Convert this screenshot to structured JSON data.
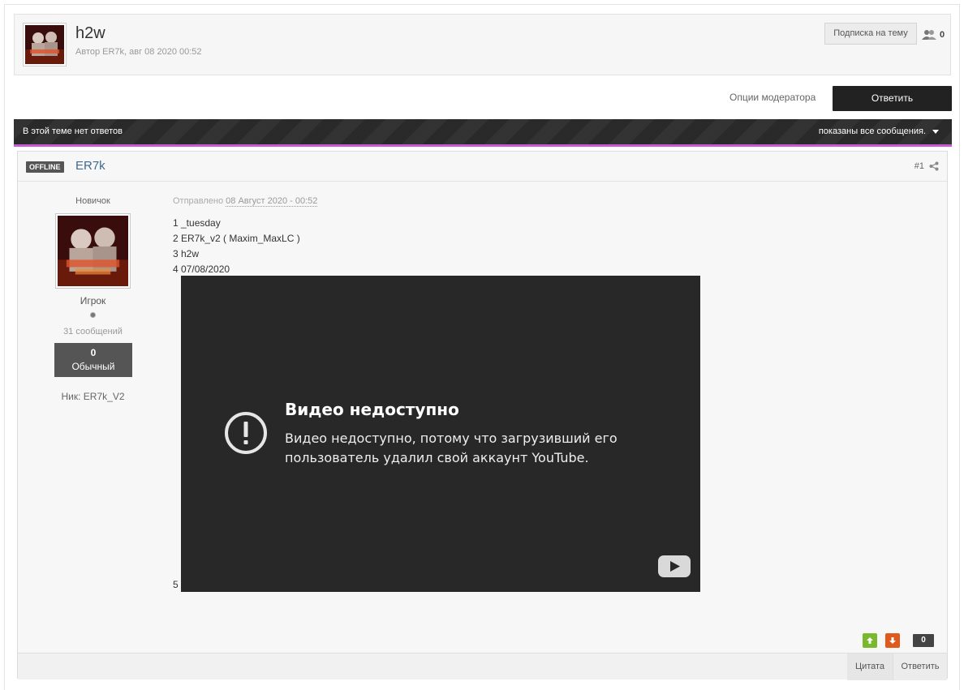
{
  "topic": {
    "title": "h2w",
    "meta": "Автор ER7k, авг 08 2020 00:52",
    "subscribe_label": "Подписка на тему",
    "followers_count": "0"
  },
  "actions": {
    "mod_options_label": "Опции модератора",
    "reply_label": "Ответить"
  },
  "topic_bar": {
    "left_text": "В этой теме нет ответов",
    "right_text": "показаны все сообщения."
  },
  "post": {
    "status_badge": "OFFLINE",
    "author": "ER7k",
    "number": "#1",
    "rank_title": "Новичок",
    "group": "Игрок",
    "post_count": "31 сообщений",
    "reputation_value": "0",
    "reputation_label": "Обычный",
    "nick_label": "Ник:",
    "nick_value": "ER7k_V2",
    "posted_prefix": "Отправлено",
    "posted_date": "08 Август 2020 - 00:52",
    "lines": [
      "1 _tuesday",
      "2 ER7k_v2 ( Maxim_MaxLC )",
      "3 h2w",
      "4 07/08/2020"
    ],
    "line5": "5",
    "video": {
      "title": "Видео недоступно",
      "message": "Видео недоступно, потому что загрузивший его пользователь удалил свой аккаунт YouTube."
    },
    "rep_count": "0",
    "quote_label": "Цитата",
    "reply_label": "Ответить"
  },
  "colors": {
    "accent_bar": "#c65bd3",
    "author_link": "#3d6a8f",
    "vote_up": "#7ab82d",
    "vote_down": "#e05a1e"
  },
  "icons": [
    "followers-icon",
    "caret-down-icon",
    "share-icon",
    "alert-icon",
    "youtube-play-icon",
    "arrow-up-icon",
    "arrow-down-icon"
  ]
}
